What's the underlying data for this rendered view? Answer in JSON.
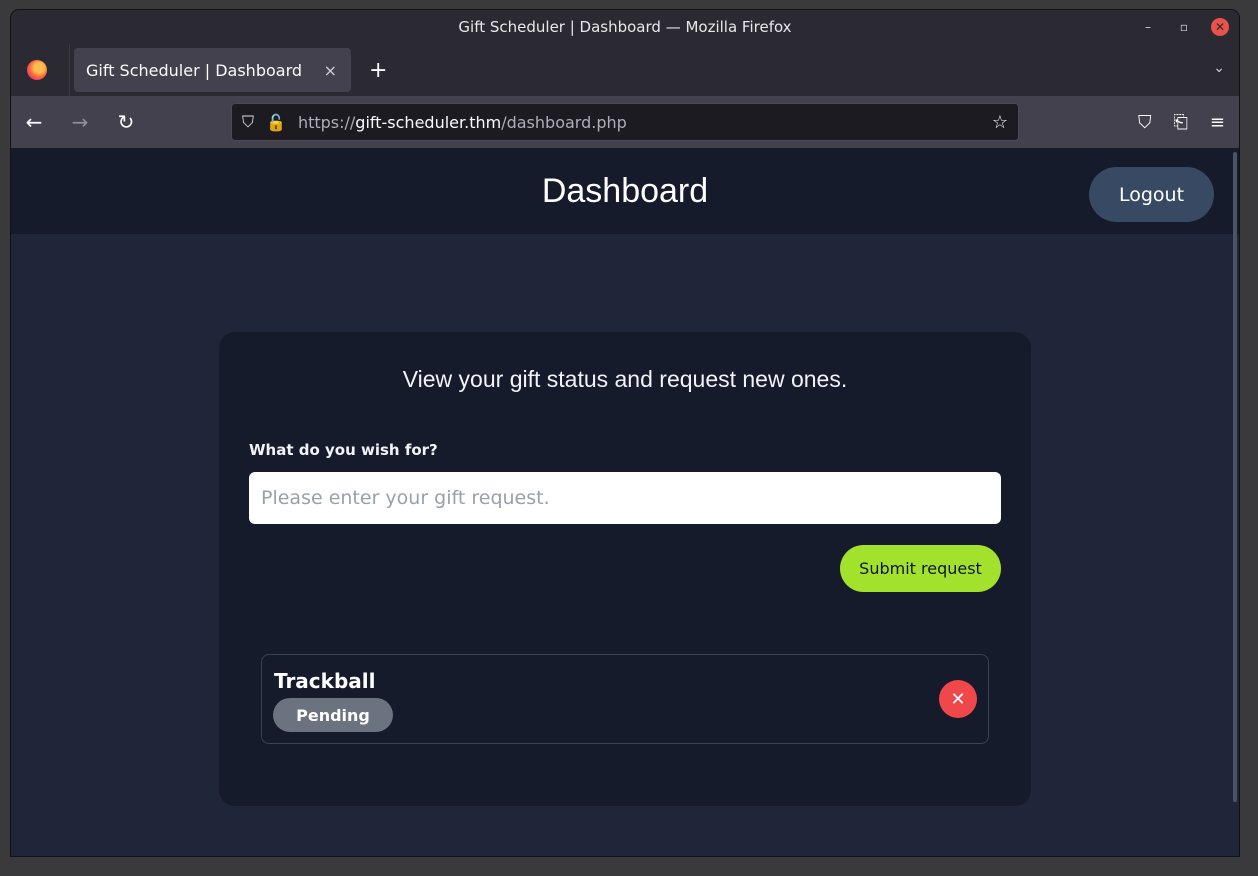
{
  "window": {
    "title": "Gift Scheduler | Dashboard — Mozilla Firefox"
  },
  "window_controls": {
    "minimize": "–",
    "restore": "▫",
    "close": "✕"
  },
  "tabs": [
    {
      "title": "Gift Scheduler | Dashboard",
      "close_icon": "×"
    }
  ],
  "new_tab_icon": "+",
  "tab_list_icon": "⌄",
  "nav": {
    "back_icon": "←",
    "forward_icon": "→",
    "reload_icon": "↻",
    "shield_icon": "⛉",
    "lock_icon": "🔓",
    "url_scheme": "https://",
    "url_host": "gift-scheduler.thm",
    "url_path": "/dashboard.php",
    "bookmark_icon": "☆",
    "pocket_icon": "⛉",
    "extensions_icon": "⎗",
    "menu_icon": "≡"
  },
  "header": {
    "title": "Dashboard",
    "logout_label": "Logout"
  },
  "card": {
    "heading": "View your gift status and request new ones.",
    "wish_label": "What do you wish for?",
    "input_placeholder": "Please enter your gift request.",
    "input_value": "",
    "submit_label": "Submit request"
  },
  "gifts": [
    {
      "name": "Trackball",
      "status": "Pending",
      "delete_icon": "✕"
    }
  ],
  "colors": {
    "accent_green": "#a3e22c",
    "danger_red": "#f0474a",
    "status_pending": "#6b7280",
    "page_bg": "#1f2639",
    "card_bg": "#161b2b"
  }
}
